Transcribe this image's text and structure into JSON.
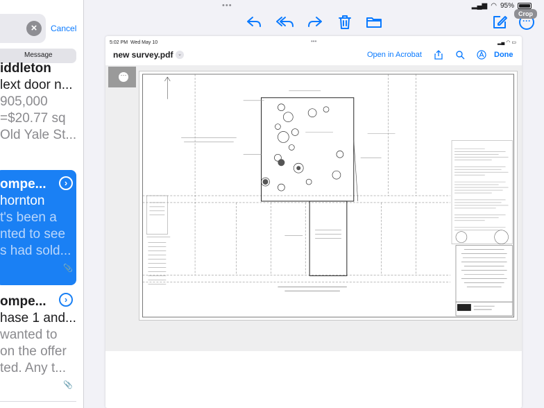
{
  "left_pane": {
    "cancel_label": "Cancel",
    "scope_label": "Message",
    "messages": [
      {
        "line1": "iddleton",
        "line2": "lext door n...",
        "line3": "905,000",
        "line4": "=$20.77 sq",
        "line5": "Old Yale St..."
      },
      {
        "line1": "ompe...",
        "line2": "hornton",
        "line3": "t's been a",
        "line4": "nted to see",
        "line5": "s had sold..."
      },
      {
        "line1": "ompe...",
        "line2": "hase 1 and...",
        "line3": " wanted to",
        "line4": "on the offer",
        "line5": "ted. Any t..."
      }
    ]
  },
  "status_bar": {
    "battery": "95%"
  },
  "toolbar": {
    "crop_tooltip": "Crop",
    "icons": [
      "reply-icon",
      "reply-all-icon",
      "forward-icon",
      "trash-icon",
      "folder-icon",
      "compose-icon",
      "more-icon"
    ]
  },
  "inner_screen": {
    "time": "5:02 PM",
    "date": "Wed May 10",
    "file_title": "new survey.pdf",
    "open_in_acrobat": "Open in Acrobat",
    "done_label": "Done"
  },
  "colors": {
    "accent": "#0a7aff",
    "selected_row": "#1a80f4"
  }
}
